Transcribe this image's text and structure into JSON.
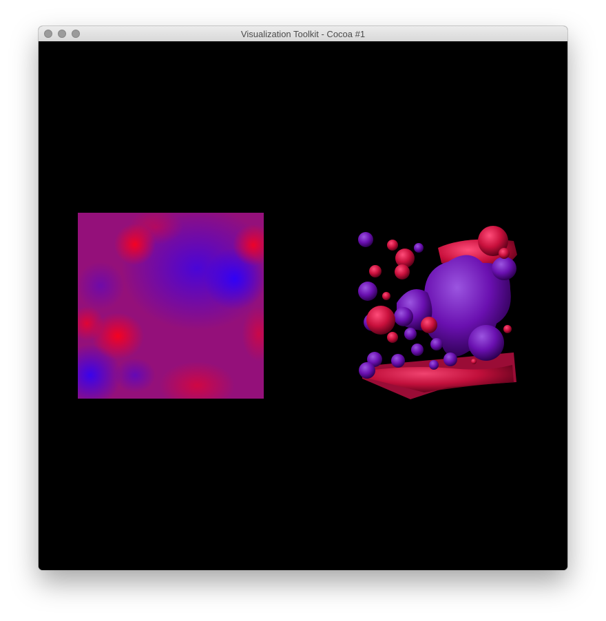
{
  "window": {
    "title": "Visualization Toolkit - Cocoa #1",
    "controls": {
      "close_icon": "circle-close-icon",
      "minimize_icon": "circle-minimize-icon",
      "zoom_icon": "circle-zoom-icon",
      "control_color": "#9b9b9b"
    }
  },
  "render": {
    "background_color": "#000000",
    "colors": {
      "high": "#ff0018",
      "low": "#2a00ff",
      "mid": "#9b0a80",
      "blob_red": "#c8103c",
      "blob_purple": "#6a10b0"
    }
  }
}
